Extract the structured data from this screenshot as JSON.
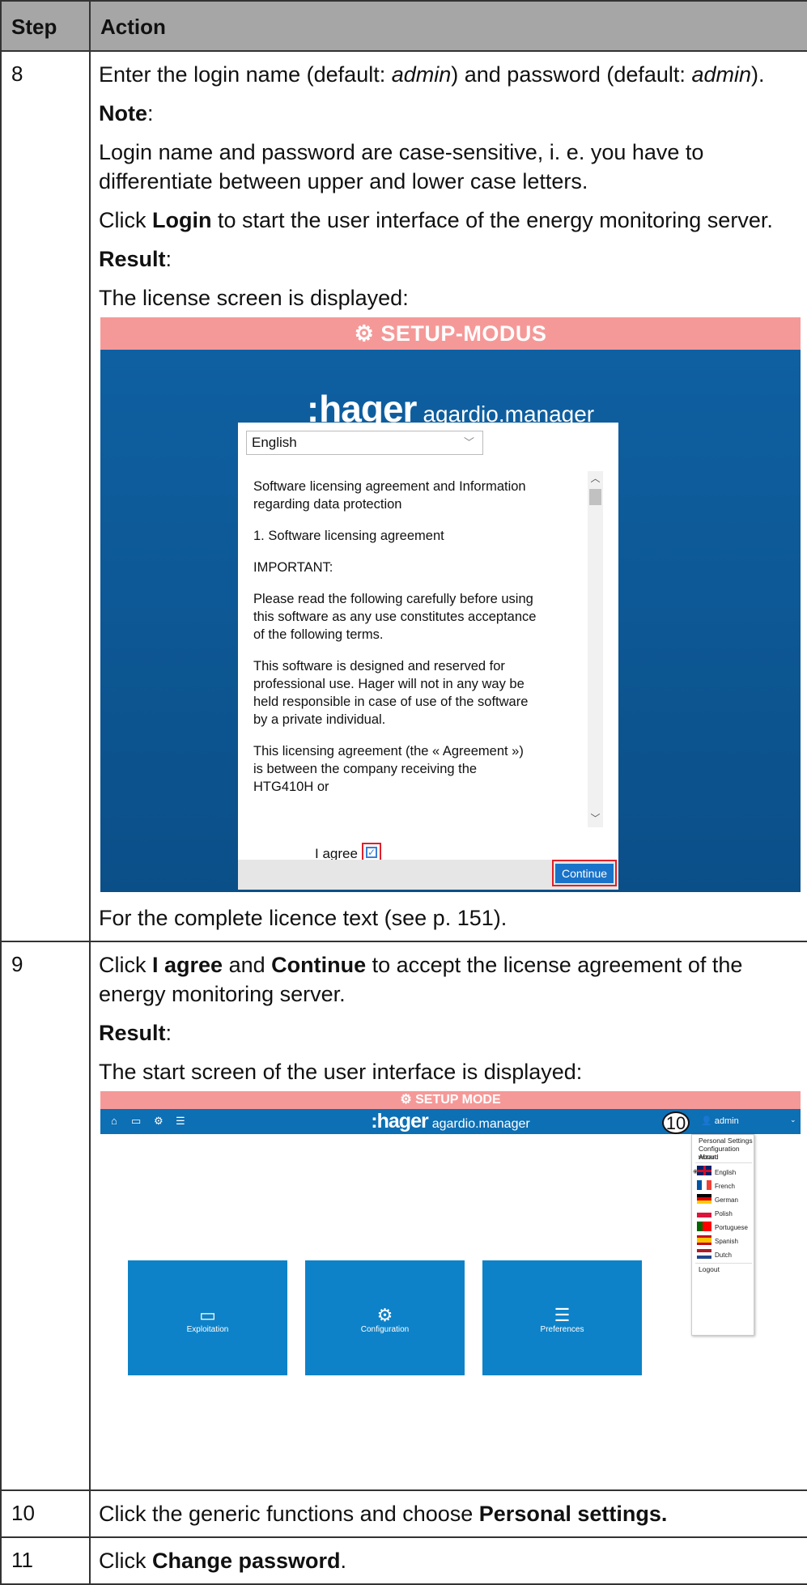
{
  "table": {
    "header": {
      "step": "Step",
      "action": "Action"
    }
  },
  "rows": {
    "r8": {
      "step": "8",
      "p1a": "Enter the login name (default: ",
      "p1b": "admin",
      "p1c": ") and password (default: ",
      "p1d": "admin",
      "p1e": ").",
      "note_label": "Note",
      "note_colon": ":",
      "note_text": "Login name and password are case-sensitive, i. e. you have to differentiate between upper and lower case letters.",
      "click_a": "Click ",
      "click_b": "Login",
      "click_c": " to start the user interface of the energy monitoring server.",
      "result_label": "Result",
      "result_colon": ":",
      "license_line": "The license screen is displayed:",
      "footer_line": "For the complete licence text (see p. 151)."
    },
    "r9": {
      "step": "9",
      "a": "Click ",
      "b": "I agree",
      "c": " and ",
      "d": "Continue",
      "e": " to accept the license agreement of the energy monitoring server.",
      "result_label": "Result",
      "result_colon": ":",
      "start_line": "The start screen of the user interface is displayed:"
    },
    "r10": {
      "step": "10",
      "a": "Click the generic functions and choose ",
      "b": "Personal settings."
    },
    "r11": {
      "step": "11",
      "a": "Click ",
      "b": "Change password",
      "c": "."
    }
  },
  "license_screen": {
    "banner": "⚙ SETUP-MODUS",
    "brand_colon": ":",
    "brand_name": "hager",
    "brand_product": "agardio.manager",
    "language_value": "English",
    "license_paragraphs": [
      "Software licensing agreement and Information regarding data protection",
      "1. Software licensing agreement",
      "IMPORTANT:",
      "Please read the following carefully before using this software as any use constitutes acceptance of the following terms.",
      "This software is designed and reserved for professional use. Hager will not in any way be held responsible in case of use of the software by a private individual.",
      "This licensing agreement (the « Agreement ») is between the company receiving the HTG410H or"
    ],
    "agree_label": "I agree",
    "continue_label": "Continue"
  },
  "start_screen": {
    "banner": "⚙ SETUP MODE",
    "brand_colon": ":",
    "brand_name": "hager",
    "brand_product": "agardio.manager",
    "user_label": "admin",
    "callout": "10",
    "menu": {
      "personal_settings": "Personal Settings",
      "configuration_wizard": "Configuration wizard",
      "about": "About",
      "languages": [
        "English",
        "French",
        "German",
        "Polish",
        "Portuguese",
        "Spanish",
        "Dutch"
      ],
      "logout": "Logout"
    },
    "tiles": [
      "Exploitation",
      "Configuration",
      "Preferences"
    ]
  },
  "colors": {
    "header_bg": "#a6a6a6",
    "setup_banner": "#f59998",
    "brand_blue": "#0d6fb4",
    "tile_blue": "#0e82c8",
    "highlight_red": "#e0202a"
  }
}
